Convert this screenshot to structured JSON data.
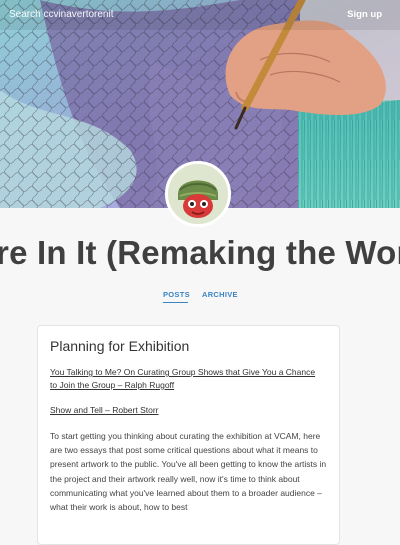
{
  "header": {
    "search_placeholder": "Search ccvinavertorenit",
    "signup_label": "Sign up"
  },
  "site": {
    "title": "'re In It (Remaking the Wor"
  },
  "nav": {
    "tabs": [
      {
        "label": "POSTS",
        "active": true
      },
      {
        "label": "ARCHIVE",
        "active": false
      }
    ]
  },
  "post": {
    "title": "Planning for Exhibition",
    "links": [
      "You Talking to Me? On Curating Group Shows that Give You a Chance to Join the Group – Ralph Rugoff",
      "Show and Tell – Robert Storr"
    ],
    "body": "To start getting you thinking about curating the exhibition at VCAM, here are two essays that post some critical questions about what it means to present artwork to the public. You've all been getting to know the artists in the project and their artwork really well, now it's time to think about communicating what you've learned about them to a broader audience – what their work is about, how to best"
  },
  "colors": {
    "accent": "#3a84c4",
    "page_background": "#f7f7f7",
    "title_text": "#404040"
  }
}
